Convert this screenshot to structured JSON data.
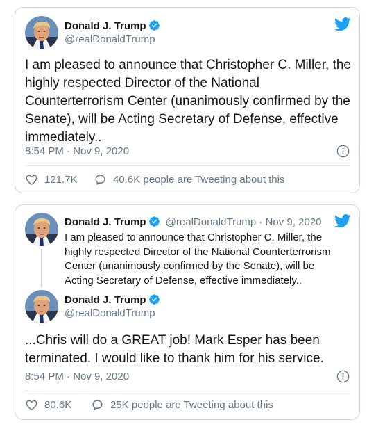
{
  "tweets": [
    {
      "author_name": "Donald J. Trump",
      "author_handle": "@realDonaldTrump",
      "text": "I am pleased to announce that Christopher C. Miller, the highly respected Director of the National Counterterrorism Center (unanimously confirmed by the Senate), will be Acting Secretary of Defense, effective immediately..",
      "timestamp": "8:54 PM · Nov 9, 2020",
      "likes": "121.7K",
      "tweeting_about": "40.6K people are Tweeting about this"
    },
    {
      "parent": {
        "author_name": "Donald J. Trump",
        "author_handle": "@realDonaldTrump",
        "separator": " · ",
        "date": "Nov 9, 2020",
        "text": "I am pleased to announce that Christopher C. Miller, the highly respected Director of the National Counterterrorism Center (unanimously confirmed by the Senate), will be Acting Secretary of Defense, effective immediately.."
      },
      "author_name": "Donald J. Trump",
      "author_handle": "@realDonaldTrump",
      "text": "...Chris will do a GREAT job! Mark Esper has been terminated. I would like to thank him for his service.",
      "timestamp": "8:54 PM · Nov 9, 2020",
      "likes": "80.6K",
      "tweeting_about": "25K people are Tweeting about this"
    }
  ],
  "colors": {
    "twitter_blue": "#1da1f2",
    "verified_blue": "#1da1f2",
    "text_primary": "#14171a",
    "text_secondary": "#657786",
    "border": "#cfd9de"
  },
  "icons": [
    "twitter-bird-icon",
    "verified-badge-icon",
    "info-icon",
    "heart-icon",
    "speech-bubble-icon"
  ]
}
